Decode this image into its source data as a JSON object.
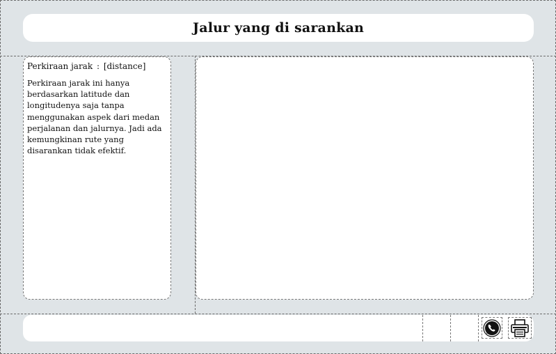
{
  "header": {
    "title": "Jalur yang di sarankan"
  },
  "sidebar": {
    "distance_label": "Perkiraan jarak",
    "distance_separator": ":",
    "distance_value": "[distance]",
    "notice": "Perkiraan jarak ini hanya berdasarkan latitude dan longitudenya saja tanpa menggunakan aspek dari medan perjalanan dan jalurnya. Jadi ada kemungkinan rute yang disarankan tidak efektif."
  },
  "footer": {
    "actions": [
      {
        "icon": "whatsapp-icon"
      },
      {
        "icon": "printer-icon"
      }
    ]
  }
}
